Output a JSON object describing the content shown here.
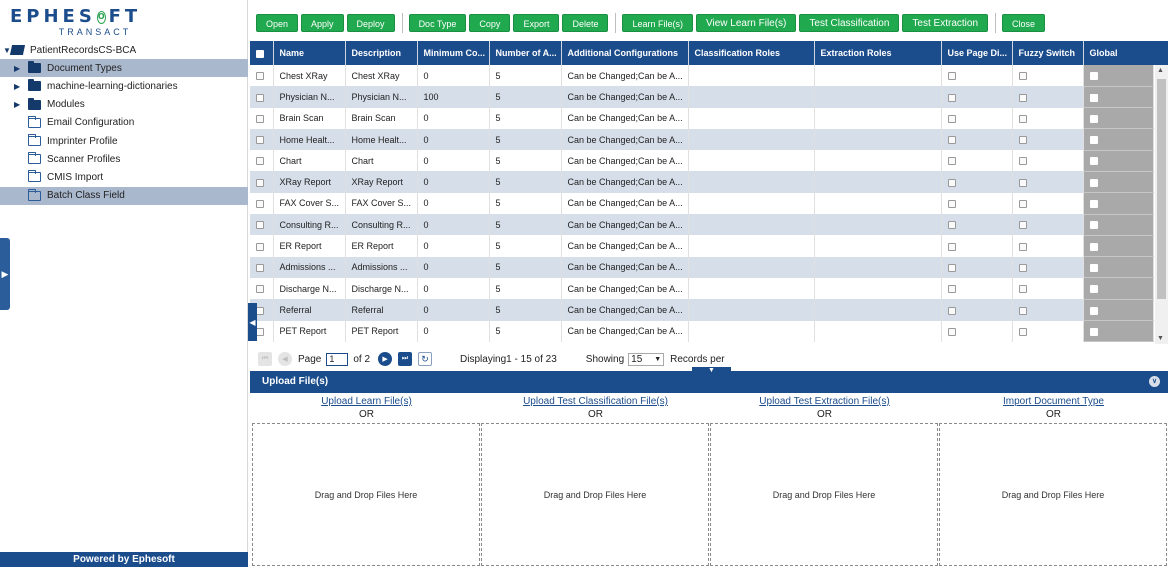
{
  "brand": {
    "name_part1": "EPHES",
    "name_mark": "O",
    "name_part2": "FT",
    "subtitle": "TRANSACT"
  },
  "tree": {
    "root": "PatientRecordsCS-BCA",
    "items": [
      {
        "label": "Document Types",
        "expandable": true,
        "selected": true
      },
      {
        "label": "machine-learning-dictionaries",
        "expandable": true
      },
      {
        "label": "Modules",
        "expandable": true
      },
      {
        "label": "Email Configuration"
      },
      {
        "label": "Imprinter Profile"
      },
      {
        "label": "Scanner Profiles"
      },
      {
        "label": "CMIS Import"
      },
      {
        "label": "Batch Class Field",
        "selected": true
      }
    ]
  },
  "footer": {
    "powered": "Powered by Ephesoft"
  },
  "toolbar": {
    "open": "Open",
    "apply": "Apply",
    "deploy": "Deploy",
    "doc_type": "Doc Type",
    "copy": "Copy",
    "export": "Export",
    "delete": "Delete",
    "learn_files": "Learn File(s)",
    "view_learn_files": "View Learn File(s)",
    "test_classification": "Test Classification",
    "test_extraction": "Test Extraction",
    "close": "Close"
  },
  "grid": {
    "columns": [
      "Name",
      "Description",
      "Minimum Co...",
      "Number of A...",
      "Additional Configurations",
      "Classification Roles",
      "Extraction Roles",
      "Use Page Di...",
      "Fuzzy Switch",
      "Global"
    ],
    "rows": [
      {
        "name": "Chest XRay",
        "description": "Chest XRay",
        "min": "0",
        "num": "5",
        "config": "Can be Changed;Can be A..."
      },
      {
        "name": "Physician N...",
        "description": "Physician N...",
        "min": "100",
        "num": "5",
        "config": "Can be Changed;Can be A..."
      },
      {
        "name": "Brain Scan",
        "description": "Brain Scan",
        "min": "0",
        "num": "5",
        "config": "Can be Changed;Can be A..."
      },
      {
        "name": "Home Healt...",
        "description": "Home Healt...",
        "min": "0",
        "num": "5",
        "config": "Can be Changed;Can be A..."
      },
      {
        "name": "Chart",
        "description": "Chart",
        "min": "0",
        "num": "5",
        "config": "Can be Changed;Can be A..."
      },
      {
        "name": "XRay Report",
        "description": "XRay Report",
        "min": "0",
        "num": "5",
        "config": "Can be Changed;Can be A..."
      },
      {
        "name": "FAX Cover S...",
        "description": "FAX Cover S...",
        "min": "0",
        "num": "5",
        "config": "Can be Changed;Can be A..."
      },
      {
        "name": "Consulting R...",
        "description": "Consulting R...",
        "min": "0",
        "num": "5",
        "config": "Can be Changed;Can be A..."
      },
      {
        "name": "ER Report",
        "description": "ER Report",
        "min": "0",
        "num": "5",
        "config": "Can be Changed;Can be A..."
      },
      {
        "name": "Admissions ...",
        "description": "Admissions ...",
        "min": "0",
        "num": "5",
        "config": "Can be Changed;Can be A..."
      },
      {
        "name": "Discharge N...",
        "description": "Discharge N...",
        "min": "0",
        "num": "5",
        "config": "Can be Changed;Can be A..."
      },
      {
        "name": "Referral",
        "description": "Referral",
        "min": "0",
        "num": "5",
        "config": "Can be Changed;Can be A..."
      },
      {
        "name": "PET Report",
        "description": "PET Report",
        "min": "0",
        "num": "5",
        "config": "Can be Changed;Can be A..."
      }
    ]
  },
  "pager": {
    "page_label": "Page",
    "page_value": "1",
    "of_label": "of 2",
    "displaying": "Displaying1 - 15 of 23",
    "showing_label": "Showing",
    "showing_value": "15",
    "records_label": "Records per"
  },
  "upload": {
    "title": "Upload File(s)",
    "columns": [
      {
        "link": "Upload Learn File(s)",
        "or": "OR",
        "drop": "Drag and Drop Files Here"
      },
      {
        "link": "Upload Test Classification File(s)",
        "or": "OR",
        "drop": "Drag and Drop Files Here"
      },
      {
        "link": "Upload Test Extraction File(s)",
        "or": "OR",
        "drop": "Drag and Drop Files Here"
      },
      {
        "link": "Import Document Type",
        "or": "OR",
        "drop": "Drag and Drop Files Here"
      }
    ]
  },
  "colors": {
    "primary": "#1b4c8c",
    "button_green": "#21a94f",
    "row_alt": "#d6dee9",
    "selected_tree": "#aab8cd",
    "global_cell": "#a9a9a9"
  }
}
